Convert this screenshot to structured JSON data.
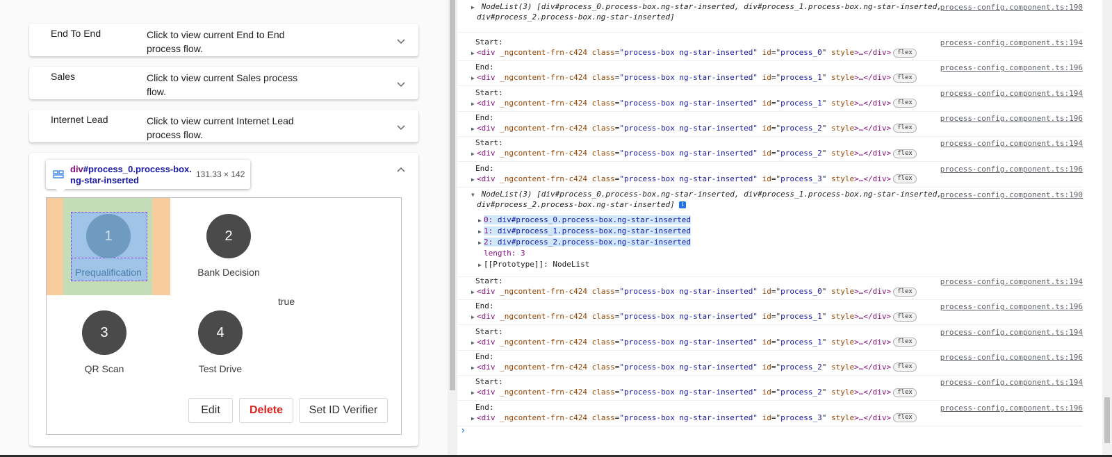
{
  "panels": [
    {
      "title": "End To End",
      "description": "Click to view current End to End process flow."
    },
    {
      "title": "Sales",
      "description": "Click to view current Sales process flow."
    },
    {
      "title": "Internet Lead",
      "description": "Click to view current Internet Lead process flow."
    }
  ],
  "inspector_tooltip": {
    "tag": "div",
    "selector_rest": "#process_0.process-box.ng-star-inserted",
    "dimensions": "131.33 × 142"
  },
  "steps": [
    {
      "number": "1",
      "label": "Prequalification"
    },
    {
      "number": "2",
      "label": "Bank Decision"
    },
    {
      "number": "3",
      "label": "QR Scan"
    },
    {
      "number": "4",
      "label": "Test Drive"
    }
  ],
  "true_text": "true",
  "buttons": {
    "edit": "Edit",
    "delete": "Delete",
    "set_id": "Set ID Verifier"
  },
  "console": {
    "nodelist_1": {
      "head": "NodeList(3) [div#process_0.process-box.ng-star-inserted, div#process_1.process-box.ng-star-inserted,",
      "head2": "div#process_2.process-box.ng-star-inserted]",
      "source": "process-config.component.ts:190"
    },
    "logs_a": [
      {
        "label": "Start:",
        "id": "process_0",
        "source": "process-config.component.ts:194"
      },
      {
        "label": "End:",
        "id": "process_1",
        "source": "process-config.component.ts:196"
      },
      {
        "label": "Start:",
        "id": "process_1",
        "source": "process-config.component.ts:194"
      },
      {
        "label": "End:",
        "id": "process_2",
        "source": "process-config.component.ts:196"
      },
      {
        "label": "Start:",
        "id": "process_2",
        "source": "process-config.component.ts:194"
      },
      {
        "label": "End:",
        "id": "process_3",
        "source": "process-config.component.ts:196"
      }
    ],
    "nodelist_2": {
      "head": "NodeList(3) [div#process_0.process-box.ng-star-inserted, div#process_1.process-box.ng-star-inserted,",
      "head2": "div#process_2.process-box.ng-star-inserted]",
      "source": "process-config.component.ts:190",
      "items": [
        {
          "key": "0:",
          "value": "div#process_0.process-box.ng-star-inserted"
        },
        {
          "key": "1:",
          "value": "div#process_1.process-box.ng-star-inserted"
        },
        {
          "key": "2:",
          "value": "div#process_2.process-box.ng-star-inserted"
        }
      ],
      "length_line": "length: 3",
      "prototype_line": "[[Prototype]]: NodeList"
    },
    "logs_b": [
      {
        "label": "Start:",
        "id": "process_0",
        "source": "process-config.component.ts:194"
      },
      {
        "label": "End:",
        "id": "process_1",
        "source": "process-config.component.ts:196"
      },
      {
        "label": "Start:",
        "id": "process_1",
        "source": "process-config.component.ts:194"
      },
      {
        "label": "End:",
        "id": "process_2",
        "source": "process-config.component.ts:196"
      },
      {
        "label": "Start:",
        "id": "process_2",
        "source": "process-config.component.ts:194"
      },
      {
        "label": "End:",
        "id": "process_3",
        "source": "process-config.component.ts:196"
      }
    ],
    "element_tag": "div",
    "attr_ng": "_ngcontent-frn-c424",
    "attr_class": "class",
    "class_value": "\"process-box ng-star-inserted\"",
    "attr_id": "id",
    "attr_style": "style",
    "ellipsis": ">…</",
    "flex_badge": "flex",
    "prompt": "›"
  }
}
